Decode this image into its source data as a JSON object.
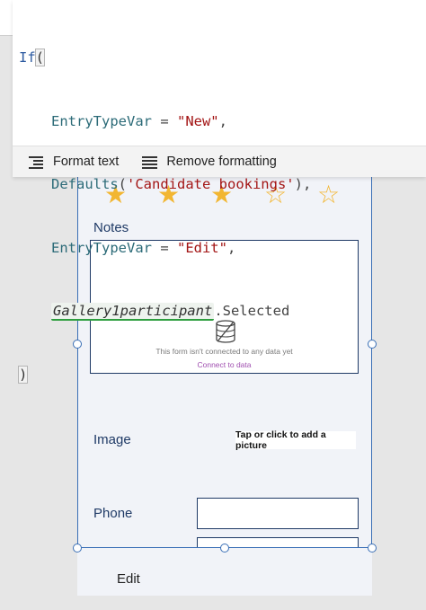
{
  "formula": {
    "line1_fn": "If",
    "line1_paren": "(",
    "line2_var": "EntryTypeVar",
    "line2_op": " = ",
    "line2_str": "\"New\"",
    "line2_comma": ",",
    "line3_fn": "Defaults",
    "line3_open": "(",
    "line3_str": "'Candidate bookings'",
    "line3_close": "),",
    "line4_var": "EntryTypeVar",
    "line4_op": " = ",
    "line4_str": "\"Edit\"",
    "line4_comma": ",",
    "line5_ctl": "Gallery1participant",
    "line5_prop": ".Selected",
    "line6_paren": ")"
  },
  "toolbar": {
    "format_label": "Format text",
    "remove_label": "Remove formatting",
    "format_icon": "format-text-icon",
    "remove_icon": "remove-formatting-icon"
  },
  "form": {
    "rating": {
      "value": 3,
      "max": 5
    },
    "notes_label": "Notes",
    "notes_empty_message": "This form isn't connected to any data yet",
    "notes_connect_link": "Connect to data",
    "image_label": "Image",
    "image_button": "Tap or click to add a picture",
    "phone_label": "Phone",
    "phone_value": "",
    "edit_label": "Edit"
  },
  "colors": {
    "star": "#f2b632",
    "label": "#1f3a66",
    "selection": "#3a6fb6",
    "link": "#a04fb0",
    "underline": "#2e9e3f"
  }
}
